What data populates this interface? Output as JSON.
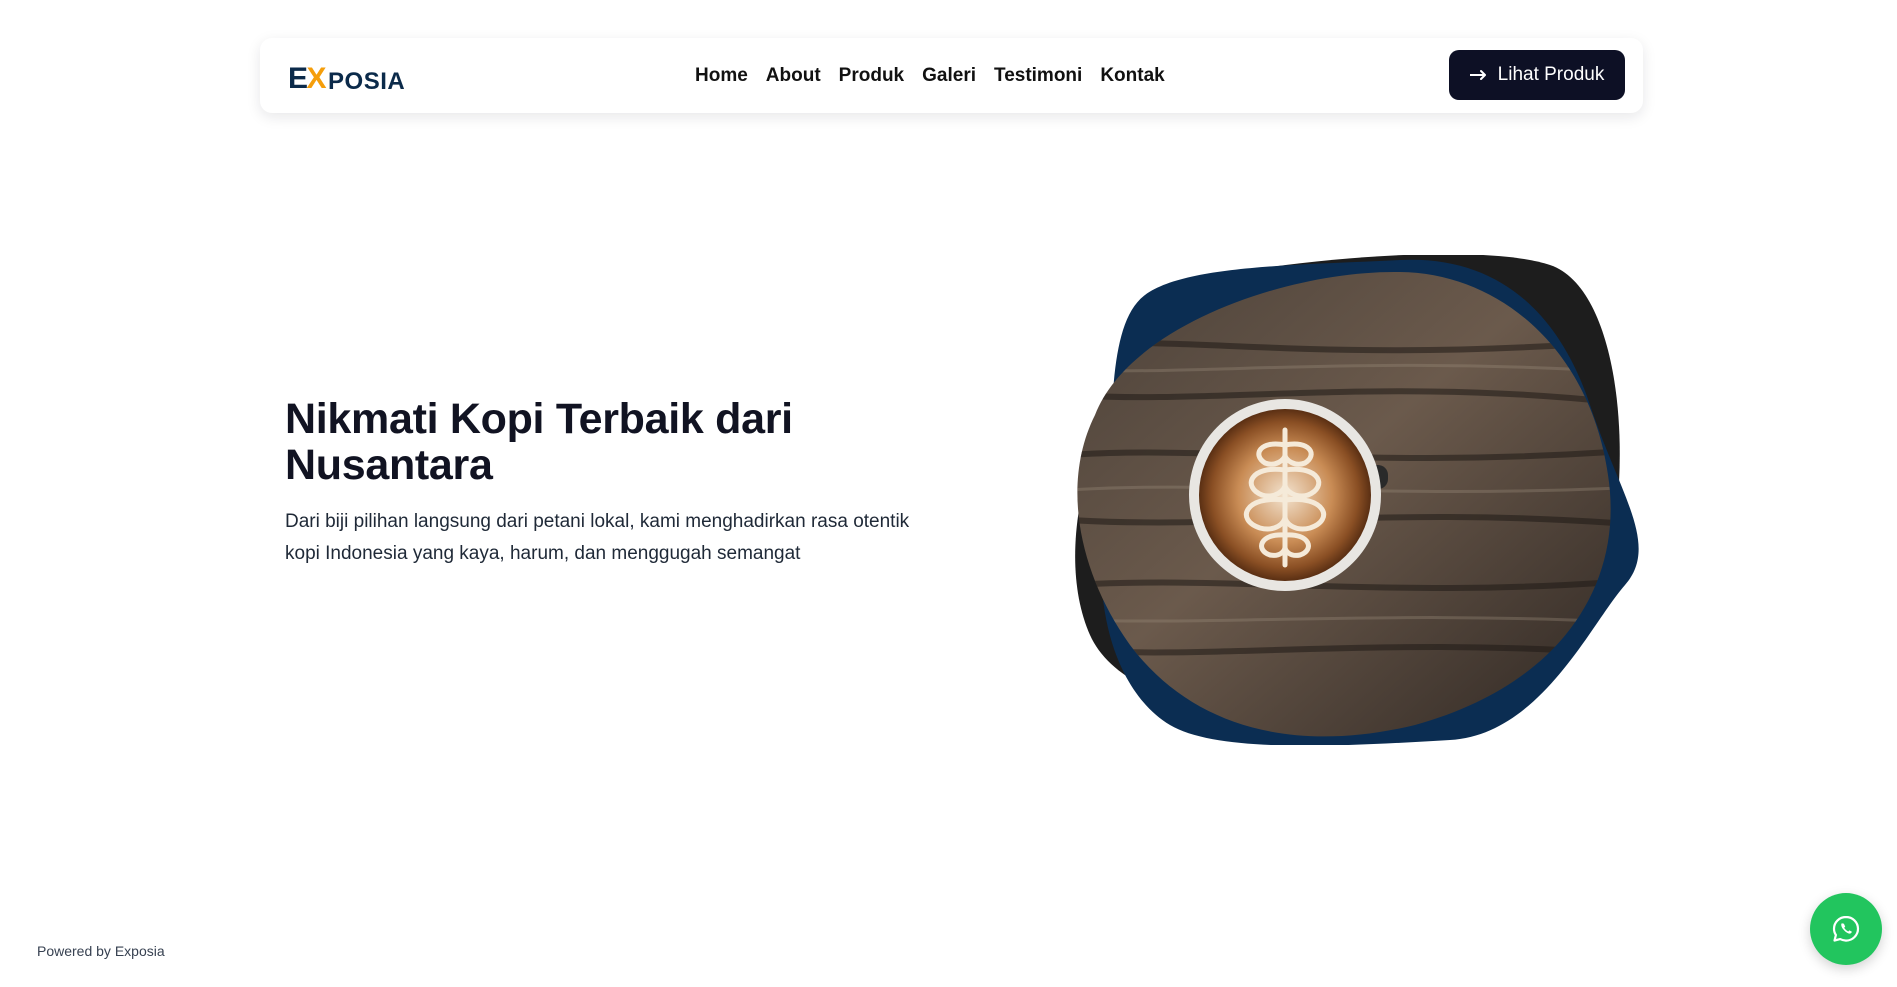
{
  "brand": {
    "logo_e": "E",
    "logo_x": "X",
    "logo_rest": "POSIA",
    "primary_color": "#0b2a4a",
    "accent_color": "#f59e0b"
  },
  "nav": {
    "items": [
      {
        "label": "Home"
      },
      {
        "label": "About"
      },
      {
        "label": "Produk"
      },
      {
        "label": "Galeri"
      },
      {
        "label": "Testimoni"
      },
      {
        "label": "Kontak"
      }
    ],
    "cta_label": "Lihat Produk",
    "cta_icon": "arrow-right-icon",
    "cta_color": "#0d1025"
  },
  "hero": {
    "title": "Nikmati Kopi Terbaik dari Nusantara",
    "description": "Dari biji pilihan langsung dari petani lokal, kami menghadirkan rasa otentik kopi Indonesia yang kaya, harum, dan menggugah semangat",
    "blob_colors": [
      "#0b2d52",
      "#1d1d1d"
    ]
  },
  "footer": {
    "credit": "Powered by Exposia"
  },
  "floating": {
    "whatsapp_icon": "whatsapp-icon",
    "whatsapp_color": "#22c55e"
  }
}
